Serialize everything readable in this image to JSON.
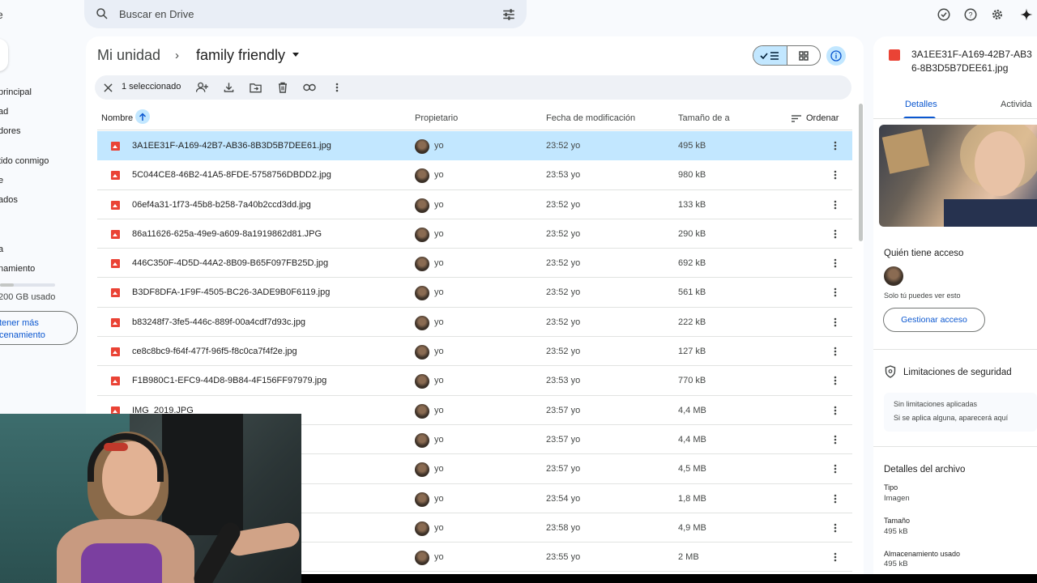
{
  "app": {
    "logo_fragment": "e"
  },
  "search": {
    "placeholder": "Buscar en Drive"
  },
  "sidebar": {
    "items": [
      {
        "label": "principal"
      },
      {
        "label": "ad"
      },
      {
        "label": "dores"
      },
      {
        "label": "tido conmigo"
      },
      {
        "label": "e"
      },
      {
        "label": "ados"
      },
      {
        "label": "a"
      },
      {
        "label": "namiento"
      }
    ],
    "storage_text": "200 GB usado",
    "storage_fraction": 0.25,
    "more_storage_line1": "tener más",
    "more_storage_line2": "cenamiento"
  },
  "breadcrumb": {
    "root": "Mi unidad",
    "separator": "›",
    "current": "family friendly"
  },
  "selection": {
    "count_label": "1 seleccionado"
  },
  "table": {
    "headers": {
      "name": "Nombre",
      "owner": "Propietario",
      "modified": "Fecha de modificación",
      "size": "Tamaño de a",
      "sort": "Ordenar"
    },
    "rows": [
      {
        "name": "3A1EE31F-A169-42B7-AB36-8B3D5B7DEE61.jpg",
        "owner": "yo",
        "modified": "23:52 yo",
        "size": "495 kB",
        "selected": true
      },
      {
        "name": "5C044CE8-46B2-41A5-8FDE-5758756DBDD2.jpg",
        "owner": "yo",
        "modified": "23:53 yo",
        "size": "980 kB"
      },
      {
        "name": "06ef4a31-1f73-45b8-b258-7a40b2ccd3dd.jpg",
        "owner": "yo",
        "modified": "23:52 yo",
        "size": "133 kB"
      },
      {
        "name": "86a11626-625a-49e9-a609-8a1919862d81.JPG",
        "owner": "yo",
        "modified": "23:52 yo",
        "size": "290 kB"
      },
      {
        "name": "446C350F-4D5D-44A2-8B09-B65F097FB25D.jpg",
        "owner": "yo",
        "modified": "23:52 yo",
        "size": "692 kB"
      },
      {
        "name": "B3DF8DFA-1F9F-4505-BC26-3ADE9B0F6119.jpg",
        "owner": "yo",
        "modified": "23:52 yo",
        "size": "561 kB"
      },
      {
        "name": "b83248f7-3fe5-446c-889f-00a4cdf7d93c.jpg",
        "owner": "yo",
        "modified": "23:52 yo",
        "size": "222 kB"
      },
      {
        "name": "ce8c8bc9-f64f-477f-96f5-f8c0ca7f4f2e.jpg",
        "owner": "yo",
        "modified": "23:52 yo",
        "size": "127 kB"
      },
      {
        "name": "F1B980C1-EFC9-44D8-9B84-4F156FF97979.jpg",
        "owner": "yo",
        "modified": "23:53 yo",
        "size": "770 kB"
      },
      {
        "name": "IMG_2019.JPG",
        "owner": "yo",
        "modified": "23:57 yo",
        "size": "4,4 MB"
      },
      {
        "name": "",
        "owner": "yo",
        "modified": "23:57 yo",
        "size": "4,4 MB"
      },
      {
        "name": "",
        "owner": "yo",
        "modified": "23:57 yo",
        "size": "4,5 MB"
      },
      {
        "name": "",
        "owner": "yo",
        "modified": "23:54 yo",
        "size": "1,8 MB"
      },
      {
        "name": "",
        "owner": "yo",
        "modified": "23:58 yo",
        "size": "4,9 MB"
      },
      {
        "name": "",
        "owner": "yo",
        "modified": "23:55 yo",
        "size": "2 MB"
      }
    ]
  },
  "details": {
    "title": "3A1EE31F-A169-42B7-AB36-8B3D5B7DEE61.jpg",
    "tab_details": "Detalles",
    "tab_activity": "Activida",
    "access_heading": "Quién tiene acceso",
    "access_note": "Solo tú puedes ver esto",
    "manage_access": "Gestionar acceso",
    "security_heading": "Limitaciones de seguridad",
    "security_line1": "Sin limitaciones aplicadas",
    "security_line2": "Si se aplica alguna, aparecerá aquí",
    "file_details_heading": "Detalles del archivo",
    "type_label": "Tipo",
    "type_value": "Imagen",
    "size_label": "Tamaño",
    "size_value": "495 kB",
    "storage_label": "Almacenamiento usado",
    "storage_value": "495 kB"
  },
  "colors": {
    "accent": "#0b57d0",
    "selected_row": "#c2e7ff",
    "image_icon": "#ea4335"
  },
  "icons": {
    "search": "search-icon",
    "filters": "tune-icon",
    "offline": "check-circle-icon",
    "help": "help-icon",
    "settings": "gear-icon",
    "gemini": "sparkle-icon"
  }
}
